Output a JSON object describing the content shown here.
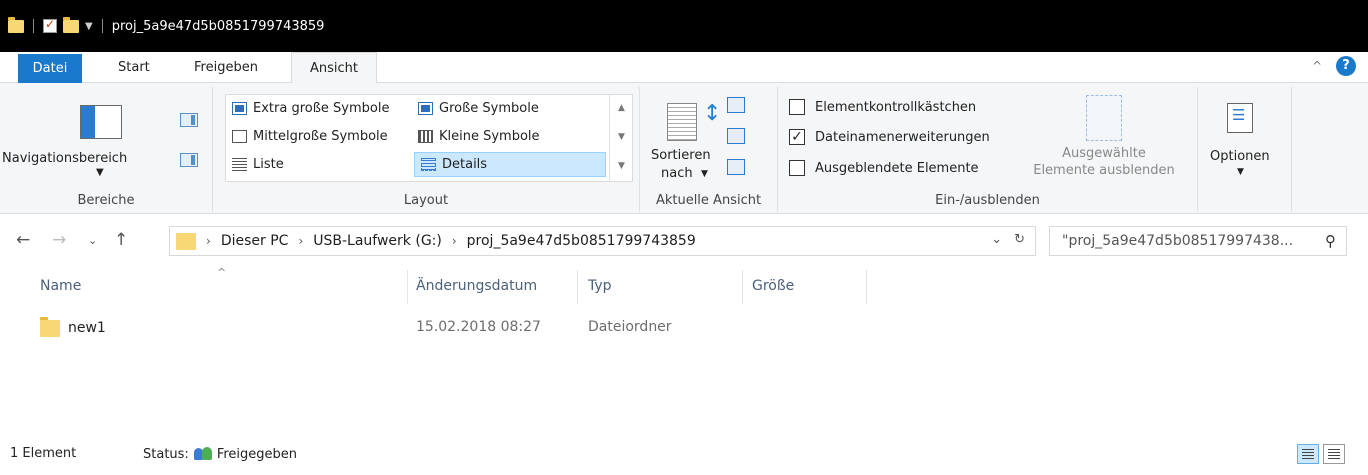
{
  "window": {
    "title": "proj_5a9e47d5b0851799743859",
    "quick_access": [
      "folder-icon",
      "properties-icon",
      "new-folder-icon",
      "customize-down-icon"
    ]
  },
  "tabs": [
    {
      "label": "Datei"
    },
    {
      "label": "Start"
    },
    {
      "label": "Freigeben"
    },
    {
      "label": "Ansicht",
      "active": true
    }
  ],
  "ribbon": {
    "bereiche": {
      "group_label": "Bereiche",
      "navpane_label": "Navigationsbereich"
    },
    "layout": {
      "group_label": "Layout",
      "items": [
        {
          "label": "Extra große Symbole"
        },
        {
          "label": "Große Symbole"
        },
        {
          "label": "Mittelgroße Symbole"
        },
        {
          "label": "Kleine Symbole"
        },
        {
          "label": "Liste"
        },
        {
          "label": "Details",
          "selected": true
        }
      ]
    },
    "aktuelle_ansicht": {
      "group_label": "Aktuelle Ansicht",
      "sort_label_1": "Sortieren",
      "sort_label_2": "nach"
    },
    "ein_ausblenden": {
      "group_label": "Ein-/ausblenden",
      "checkboxes": [
        {
          "label": "Elementkontrollkästchen",
          "checked": false
        },
        {
          "label": "Dateinamenerweiterungen",
          "checked": true
        },
        {
          "label": "Ausgeblendete Elemente",
          "checked": false
        }
      ],
      "hide_label_1": "Ausgewählte",
      "hide_label_2": "Elemente ausblenden"
    },
    "optionen": {
      "label": "Optionen"
    }
  },
  "address": {
    "breadcrumb": [
      "Dieser PC",
      "USB-Laufwerk (G:)",
      "proj_5a9e47d5b0851799743859"
    ],
    "search_placeholder": "\"proj_5a9e47d5b08517997438..."
  },
  "columns": [
    "Name",
    "Änderungsdatum",
    "Typ",
    "Größe"
  ],
  "rows": [
    {
      "name": "new1",
      "date": "15.02.2018 08:27",
      "type": "Dateiordner",
      "size": ""
    }
  ],
  "status": {
    "count": "1 Element",
    "status_label": "Status:",
    "status_value": "Freigegeben"
  },
  "colors": {
    "accent": "#1979ca",
    "folder": "#f8d775",
    "selection": "#cce8ff"
  }
}
